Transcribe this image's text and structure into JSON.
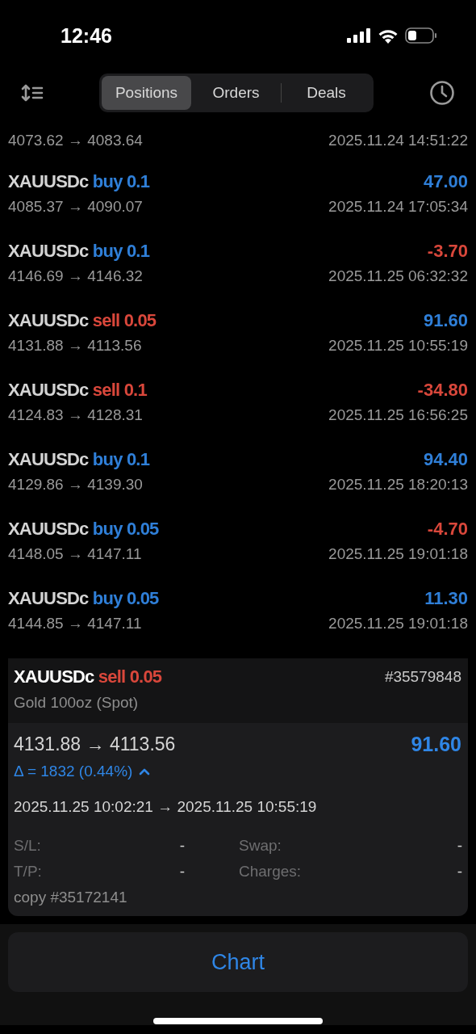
{
  "status_bar": {
    "time": "12:46"
  },
  "tabs": [
    {
      "label": "Positions",
      "selected": true
    },
    {
      "label": "Orders",
      "selected": false
    },
    {
      "label": "Deals",
      "selected": false
    }
  ],
  "deals": [
    {
      "prices": "4073.62 → 4083.64",
      "time": "2025.11.24 14:51:22"
    },
    {
      "symbol": "XAUUSDc",
      "kind": "buy",
      "trade": "buy 0.1",
      "profit": "47.00",
      "color": "#2f7fd8",
      "prices": "4085.37 → 4090.07",
      "time": "2025.11.24 17:05:34"
    },
    {
      "symbol": "XAUUSDc",
      "kind": "buy",
      "trade": "buy 0.1",
      "profit": "-3.70",
      "color": "#d9473b",
      "prices": "4146.69 → 4146.32",
      "time": "2025.11.25 06:32:32"
    },
    {
      "symbol": "XAUUSDc",
      "kind": "sell",
      "trade": "sell 0.05",
      "profit": "91.60",
      "color": "#2f7fd8",
      "prices": "4131.88 → 4113.56",
      "time": "2025.11.25 10:55:19"
    },
    {
      "symbol": "XAUUSDc",
      "kind": "sell",
      "trade": "sell 0.1",
      "profit": "-34.80",
      "color": "#d9473b",
      "prices": "4124.83 → 4128.31",
      "time": "2025.11.25 16:56:25"
    },
    {
      "symbol": "XAUUSDc",
      "kind": "buy",
      "trade": "buy 0.1",
      "profit": "94.40",
      "color": "#2f7fd8",
      "prices": "4129.86 → 4139.30",
      "time": "2025.11.25 18:20:13"
    },
    {
      "symbol": "XAUUSDc",
      "kind": "buy",
      "trade": "buy 0.05",
      "profit": "-4.70",
      "color": "#d9473b",
      "prices": "4148.05 → 4147.11",
      "time": "2025.11.25 19:01:18"
    },
    {
      "symbol": "XAUUSDc",
      "kind": "buy",
      "trade": "buy 0.05",
      "profit": "11.30",
      "color": "#2f7fd8",
      "prices": "4144.85 → 4147.11",
      "time": "2025.11.25 19:01:18"
    }
  ],
  "detail": {
    "symbol": "XAUUSDc",
    "kind": "sell",
    "trade": "sell 0.05",
    "ticket": "#35579848",
    "description": "Gold 100oz (Spot)",
    "prices": "4131.88 → 4113.56",
    "profit": "91.60",
    "color": "#2f86e6",
    "delta": "Δ = 1832 (0.44%)",
    "expanded": true,
    "times": "2025.11.25 10:02:21 → 2025.11.25 10:55:19",
    "fields": [
      {
        "label": "S/L:",
        "value": "-"
      },
      {
        "label": "Swap:",
        "value": "-"
      },
      {
        "label": "T/P:",
        "value": "-"
      },
      {
        "label": "Charges:",
        "value": "-"
      }
    ],
    "comment": "copy #35172141"
  },
  "chart_button": "Chart"
}
